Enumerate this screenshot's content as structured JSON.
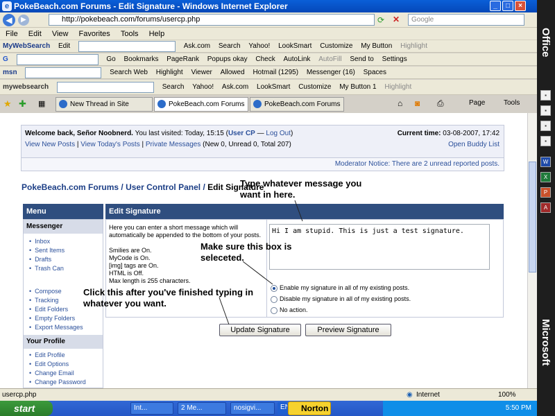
{
  "window": {
    "title": "PokeBeach.com Forums - Edit Signature - Windows Internet Explorer"
  },
  "address": {
    "url": "http://pokebeach.com/forums/usercp.php",
    "search_placeholder": "Google"
  },
  "menu": [
    "File",
    "Edit",
    "View",
    "Favorites",
    "Tools",
    "Help"
  ],
  "toolbars": {
    "mywebsearch": [
      "MyWebSearch",
      "Edit",
      "Ask.com",
      "Search",
      "Yahoo!",
      "LookSmart",
      "Customize",
      "My Button",
      "Highlight"
    ],
    "google": [
      "Go",
      "Bookmarks",
      "PageRank",
      "Popups okay",
      "Check",
      "AutoLink",
      "AutoFill",
      "Send to",
      "Settings"
    ],
    "msn": [
      "msn",
      "Search Web",
      "Highlight",
      "Viewer",
      "Allowed",
      "Hotmail (1295)",
      "Messenger (16)",
      "Spaces"
    ],
    "mywebsearch2": [
      "mywebsearch",
      "Search",
      "Yahoo!",
      "Ask.com",
      "LookSmart",
      "Customize",
      "My Button 1",
      "Highlight"
    ]
  },
  "tabs": [
    "New Thread in Site Discussion",
    "PokeBeach.com Forums - ...",
    "PokeBeach.com Forums"
  ],
  "tab_tools": [
    "Page",
    "Tools"
  ],
  "welcome": {
    "greeting": "Welcome back, Señor Noobnerd.",
    "visit": "You last visited: Today, 15:15",
    "usercp": "User CP",
    "logout": "Log Out",
    "links": [
      "View New Posts",
      "View Today's Posts",
      "Private Messages"
    ],
    "pm_counts": "(New 0, Unread 0, Total 207)",
    "time_label": "Current time:",
    "time_value": "03-08-2007, 17:42",
    "buddy": "Open Buddy List"
  },
  "notice": "Moderator Notice: There are 2 unread reported posts.",
  "breadcrumb": {
    "home": "PokeBeach.com Forums",
    "sep": "/",
    "cp": "User Control Panel",
    "current": "Edit Signature"
  },
  "sidebar": {
    "title": "Menu",
    "messenger": {
      "title": "Messenger",
      "items": [
        "Inbox",
        "Sent Items",
        "Drafts",
        "Trash Can",
        "Compose",
        "Tracking",
        "Edit Folders",
        "Empty Folders",
        "Export Messages"
      ]
    },
    "profile": {
      "title": "Your Profile",
      "items": [
        "Edit Profile",
        "Edit Options",
        "Change Email",
        "Change Password"
      ]
    }
  },
  "editor": {
    "header": "Edit Signature",
    "desc": [
      "Here you can enter a short message which will automatically be appended to the bottom of your posts.",
      "Smilies are On.",
      "MyCode is On.",
      "[img] tags are On.",
      "HTML is Off.",
      "Max length is 255 characters."
    ],
    "signature": "Hi I am stupid. This is just a test signature.",
    "options": [
      "Enable my signature in all of my existing posts.",
      "Disable my signature in all of my existing posts.",
      "No action."
    ],
    "selected_option": 0,
    "update_button": "Update Signature",
    "preview_button": "Preview Signature"
  },
  "annotations": {
    "type_msg": "Type whatever message you want in here.",
    "box": "Make sure this box is seleceted.",
    "click": "Click this after you've finished typing in whatever you want."
  },
  "status": {
    "text": "usercp.php",
    "zone": "Internet",
    "zoom": "100%"
  },
  "taskbar": {
    "start": "start",
    "tasks": [
      "Int...",
      "2 Me...",
      "nosigvi...",
      "EN"
    ],
    "norton": "Norton",
    "clock": "5:50 PM"
  },
  "office": {
    "brand": "Office",
    "brand2": "Microsoft"
  }
}
